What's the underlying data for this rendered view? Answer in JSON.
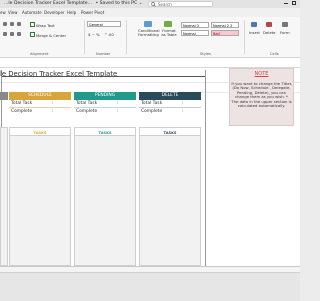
{
  "title_bar": {
    "title": "...le Decision Tracker Excel Template...",
    "saved": "• Saved to this PC ⌄"
  },
  "search": {
    "placeholder": "Search"
  },
  "ribbon_tabs": [
    "ew",
    "View",
    "Automate",
    "Developer",
    "Help",
    "Power Pivot"
  ],
  "ribbon": {
    "wrap_text": "Wrap Text",
    "merge_center": "Merge & Center",
    "number_format": "General",
    "conditional_formatting": "Conditional Formatting",
    "format_as_table": "Format as Table",
    "style_normal3": "Normal 3",
    "style_normal22": "Normal 2 2",
    "style_normal": "Normal",
    "style_bad": "Bad",
    "insert": "Insert",
    "delete": "Delete",
    "format": "Form",
    "groups": {
      "alignment": "Alignment",
      "number": "Number",
      "styles": "Styles",
      "cells": "Cells"
    }
  },
  "sheet": {
    "title": "le Decision Tracker Excel Template",
    "status_columns": [
      {
        "name": "SCHEDULE",
        "color": "#d7a63a"
      },
      {
        "name": "PENDING",
        "color": "#1f9a8c"
      },
      {
        "name": "DELETE",
        "color": "#2a4b5c"
      }
    ],
    "row_total": "Total Task",
    "row_complete": "Complete",
    "colon": ":",
    "tasks_header": "TASKS"
  },
  "note": {
    "title": "NOTE",
    "body": "If you want to change the Titles (Do Now, Schedule , Delegate, Pending, Delete), you can change them as you wish. * The data in the upper section is calculated automatically."
  }
}
